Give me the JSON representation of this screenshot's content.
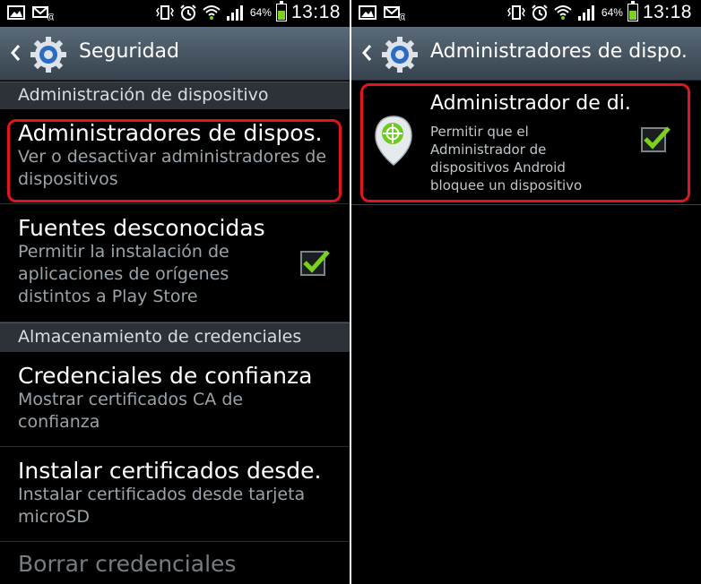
{
  "status_bar": {
    "battery_percent": "64%",
    "battery_level": 0.64,
    "time": "13:18",
    "icons": [
      "gallery-icon",
      "email-icon",
      "vibrate-icon",
      "alarm-icon",
      "wifi-icon",
      "signal-icon",
      "battery-icon"
    ]
  },
  "colors": {
    "action_bar": "#4a5866",
    "section_header": "#2c3238",
    "highlight": "#e2141e",
    "check": "#7bd11e"
  },
  "left": {
    "title": "Seguridad",
    "section_device_admin": "Administración de dispositivo",
    "device_admins": {
      "title": "Administradores de dispos.",
      "subtitle": "Ver o desactivar administradores de dispositivos"
    },
    "unknown_sources": {
      "title": "Fuentes desconocidas",
      "subtitle": "Permitir la instalación de aplicaciones de orígenes distintos a Play Store",
      "checked": true
    },
    "section_credentials": "Almacenamiento de credenciales",
    "trusted_credentials": {
      "title": "Credenciales de confianza",
      "subtitle": "Mostrar certificados CA de confianza"
    },
    "install_certificates": {
      "title": "Instalar certificados desde.",
      "subtitle": "Instalar certificados desde tarjeta microSD"
    },
    "clear_credentials": {
      "title": "Borrar credenciales"
    }
  },
  "right": {
    "title": "Administradores de dispo.",
    "admin": {
      "title": "Administrador de di.",
      "subtitle": "Permitir que el Administrador de dispositivos Android bloquee un dispositivo",
      "checked": true,
      "icon": "device-manager-icon"
    }
  }
}
